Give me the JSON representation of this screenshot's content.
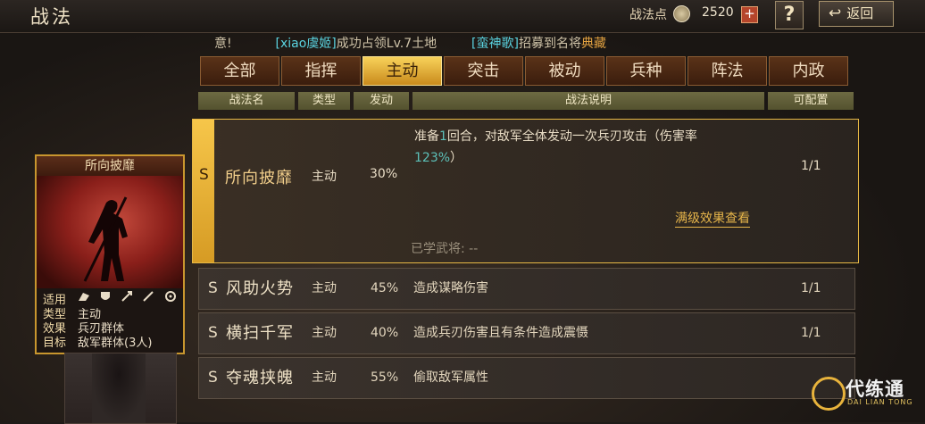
{
  "header": {
    "title": "战法",
    "points_label": "战法点",
    "points_value": "2520",
    "help_label": "?",
    "back_label": "返回"
  },
  "marquee": {
    "prefix": "意!",
    "player1": "[xiao虞姬]",
    "text1": "成功占领Lv.7土地",
    "player2": "[蛮神歌]",
    "text2": "招募到名将",
    "text3": "典藏"
  },
  "tabs": [
    {
      "label": "全部",
      "active": false
    },
    {
      "label": "指挥",
      "active": false
    },
    {
      "label": "主动",
      "active": true
    },
    {
      "label": "突击",
      "active": false
    },
    {
      "label": "被动",
      "active": false
    },
    {
      "label": "兵种",
      "active": false
    },
    {
      "label": "阵法",
      "active": false
    },
    {
      "label": "内政",
      "active": false
    }
  ],
  "columns": {
    "name": "战法名",
    "type": "类型",
    "trigger": "发动",
    "desc": "战法说明",
    "config": "可配置"
  },
  "selected_skill": {
    "grade": "S",
    "name": "所向披靡",
    "type": "主动",
    "rate": "30%",
    "desc_part1": "准备",
    "desc_round": "1",
    "desc_part2": "回合，对敌军全体发动一次兵刃攻击（伤害率",
    "desc_rate": "123%",
    "desc_end": "）",
    "config": "1/1",
    "full_effect": "满级效果查看",
    "learned": "已学武将: --"
  },
  "skills": [
    {
      "grade": "S",
      "name": "风助火势",
      "type": "主动",
      "rate": "45%",
      "desc": "造成谋略伤害",
      "config": "1/1"
    },
    {
      "grade": "S",
      "name": "横扫千军",
      "type": "主动",
      "rate": "40%",
      "desc": "造成兵刃伤害且有条件造成震慑",
      "config": "1/1"
    },
    {
      "grade": "S",
      "name": "夺魂挟魄",
      "type": "主动",
      "rate": "55%",
      "desc": "偷取敌军属性",
      "config": ""
    }
  ],
  "card": {
    "title": "所向披靡",
    "fit_label": "适用",
    "type_label": "类型",
    "type_value": "主动",
    "effect_label": "效果",
    "effect_value": "兵刃群体",
    "target_label": "目标",
    "target_value": "敌军群体(3人)"
  },
  "logo": {
    "title": "代练通",
    "subtitle": "DAI LIAN TONG"
  },
  "colors": {
    "accent_gold": "#f6c64a",
    "highlight_cyan": "#5cc0b8",
    "marquee_cyan": "#5ad3e0",
    "marquee_gold": "#e0a040"
  }
}
